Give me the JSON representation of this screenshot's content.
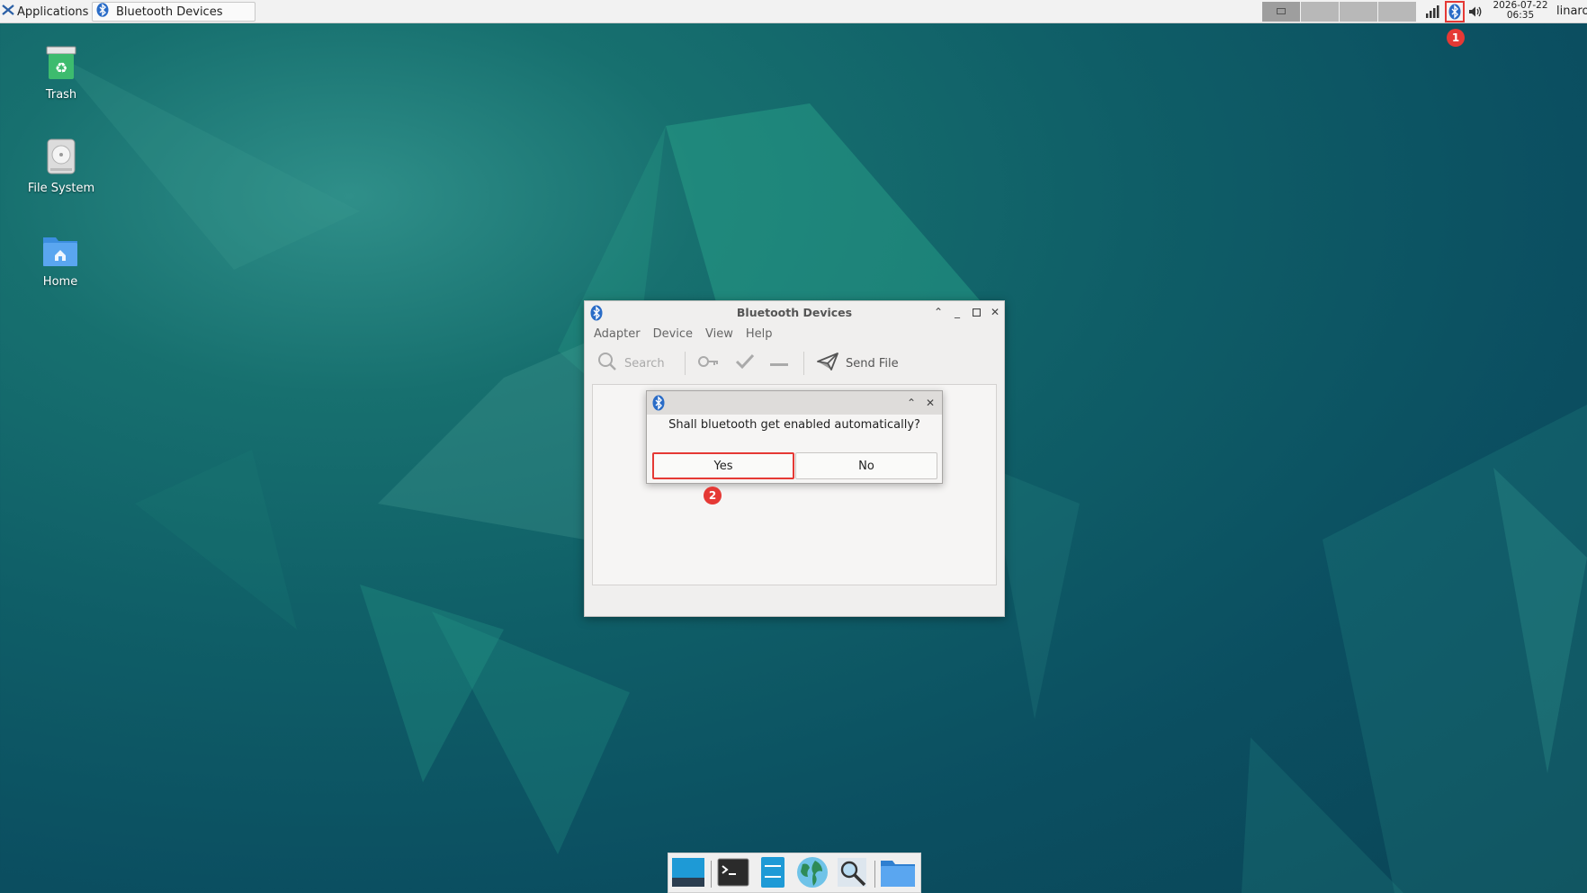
{
  "panel": {
    "applications_label": "Applications",
    "task_button_label": "Bluetooth Devices",
    "clock_date": "2026-07-22",
    "clock_time": "06:35",
    "user": "linaro"
  },
  "annotations": {
    "badge_1": "1",
    "badge_2": "2"
  },
  "desktop": {
    "icons": [
      {
        "label": "Trash"
      },
      {
        "label": "File System"
      },
      {
        "label": "Home"
      }
    ]
  },
  "window": {
    "title": "Bluetooth Devices",
    "menu": [
      "Adapter",
      "Device",
      "View",
      "Help"
    ],
    "toolbar": {
      "search_label": "Search",
      "send_file_label": "Send File"
    }
  },
  "dialog": {
    "question": "Shall bluetooth get enabled automatically?",
    "yes_label": "Yes",
    "no_label": "No"
  },
  "colors": {
    "highlight": "#e53935",
    "bluetooth": "#2a6cc7"
  },
  "icons": [
    "xfce-logo-icon",
    "bluetooth-icon",
    "network-icon",
    "volume-icon",
    "trash-icon",
    "drive-icon",
    "home-folder-icon",
    "search-icon",
    "key-icon",
    "check-icon",
    "minus-icon",
    "send-icon",
    "show-desktop-icon",
    "terminal-icon",
    "file-manager-icon",
    "web-browser-icon",
    "app-finder-icon",
    "folder-icon"
  ]
}
